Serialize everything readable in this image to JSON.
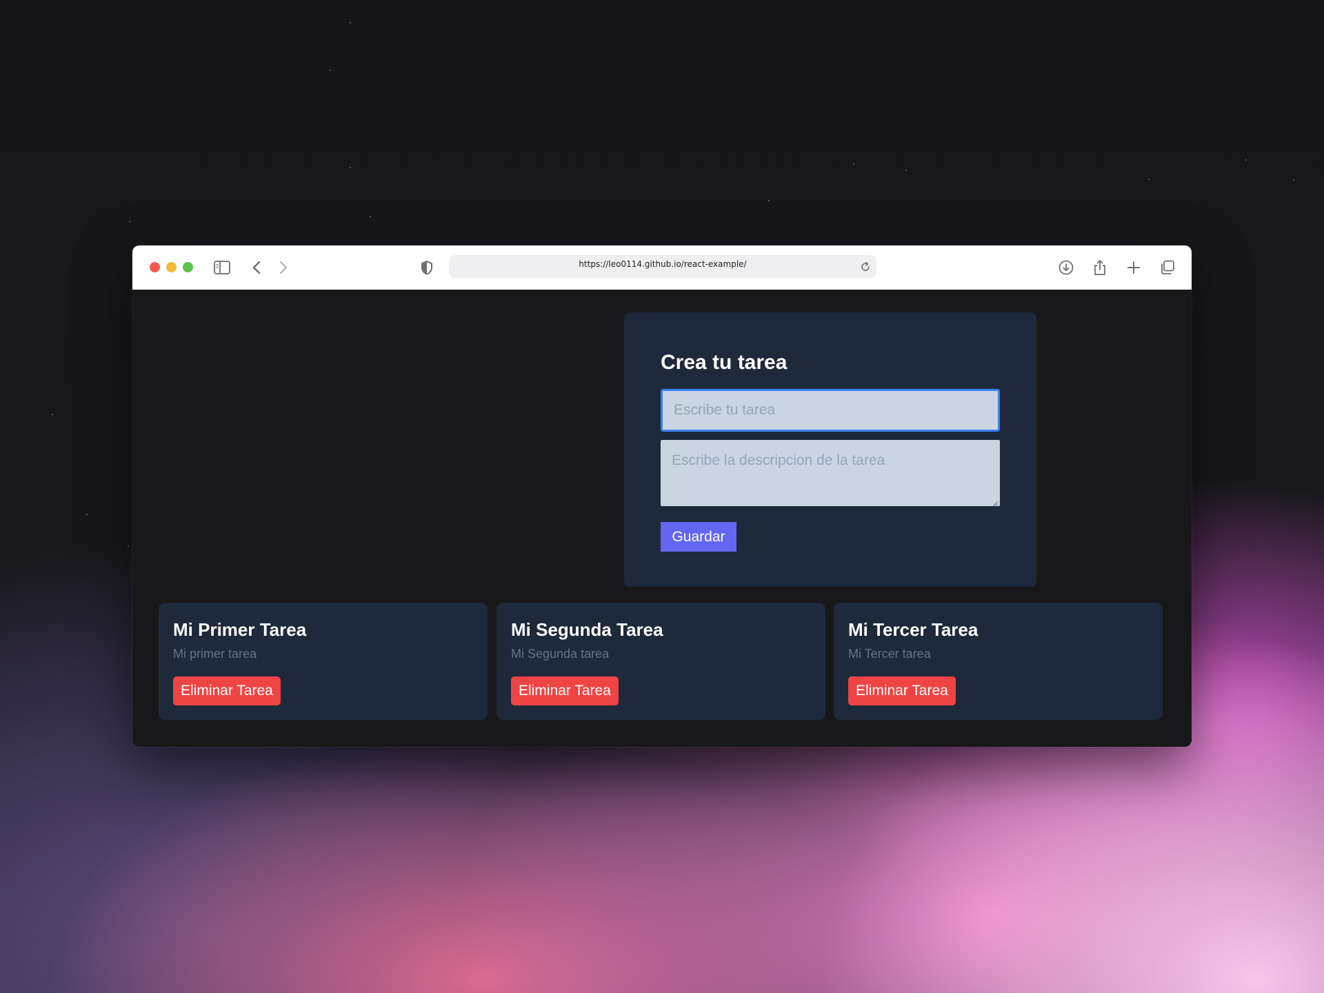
{
  "browser": {
    "url": "https://leo0114.github.io/react-example/"
  },
  "form": {
    "title": "Crea tu tarea",
    "title_placeholder": "Escribe tu tarea",
    "description_placeholder": "Escribe la descripcion de la tarea",
    "save_label": "Guardar"
  },
  "tasks": [
    {
      "title": "Mi Primer Tarea",
      "description": "Mi primer tarea",
      "delete_label": "Eliminar Tarea"
    },
    {
      "title": "Mi Segunda Tarea",
      "description": "Mi Segunda tarea",
      "delete_label": "Eliminar Tarea"
    },
    {
      "title": "Mi Tercer Tarea",
      "description": "Mi Tercer tarea",
      "delete_label": "Eliminar Tarea"
    }
  ],
  "colors": {
    "card_bg": "#1e293b",
    "page_bg": "#18181b",
    "primary_button": "#6366f1",
    "danger_button": "#ef4444",
    "input_bg": "#cbd5e1",
    "input_focus_border": "#3b82f6"
  },
  "icons": {
    "close": "close-icon",
    "minimize": "minimize-icon",
    "zoom": "zoom-icon",
    "sidebar": "sidebar-icon",
    "back": "chevron-left-icon",
    "forward": "chevron-right-icon",
    "privacy": "shield-icon",
    "reload": "reload-icon",
    "downloads": "download-icon",
    "share": "share-icon",
    "new_tab": "plus-icon",
    "tabs": "tabs-overview-icon"
  }
}
